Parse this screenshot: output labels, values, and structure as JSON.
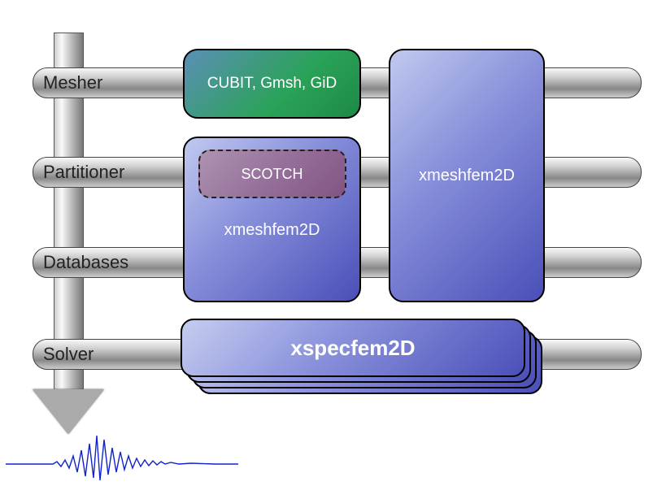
{
  "bars": {
    "mesher": "Mesher",
    "partitioner": "Partitioner",
    "databases": "Databases",
    "solver": "Solver"
  },
  "boxes": {
    "mesher_tools": "CUBIT, Gmsh, GiD",
    "scotch": "SCOTCH",
    "xmeshfem2d_left": "xmeshfem2D",
    "xmeshfem2d_right": "xmeshfem2D",
    "xspecfem2d": "xspecfem2D"
  }
}
